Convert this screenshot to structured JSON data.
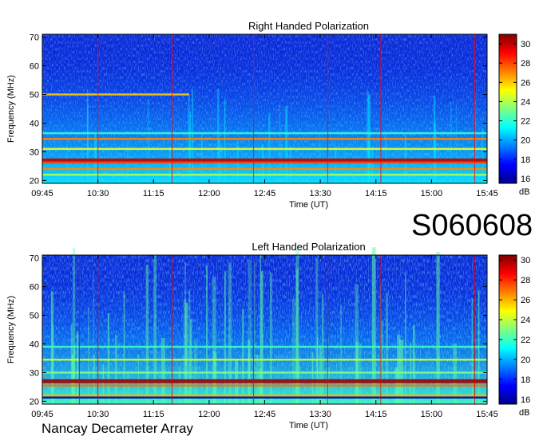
{
  "label": "S060608",
  "footer": "Nancay Decameter Array",
  "chart_data": [
    {
      "type": "heatmap",
      "title": "Right Handed Polarization",
      "xlabel": "Time (UT)",
      "ylabel": "Frequency (MHz)",
      "x_ticks": [
        "09:45",
        "10:30",
        "11:15",
        "12:00",
        "12:45",
        "13:30",
        "14:15",
        "15:00",
        "15:45"
      ],
      "y_ticks": [
        20,
        30,
        40,
        50,
        60,
        70
      ],
      "ylim": [
        19,
        71
      ],
      "colorbar": {
        "label": "dB",
        "ticks": [
          16,
          18,
          20,
          22,
          24,
          26,
          28,
          30
        ],
        "range": [
          15.5,
          31
        ]
      },
      "bands": [
        {
          "freq": 27,
          "level": 30,
          "extent": "full"
        },
        {
          "freq": 26.3,
          "level": 28,
          "extent": "full"
        },
        {
          "freq": 24,
          "level": 27,
          "extent": "full"
        },
        {
          "freq": 22,
          "level": 24,
          "extent": "full"
        },
        {
          "freq": 31,
          "level": 25,
          "extent": "full"
        },
        {
          "freq": 34.5,
          "level": 27,
          "extent": "full"
        },
        {
          "freq": 36.5,
          "level": 22,
          "extent": "full"
        },
        {
          "freq": 50,
          "level": 26,
          "extent": "partial"
        }
      ],
      "marker_times": [
        "10:30",
        "11:30",
        "12:36",
        "13:36",
        "14:19",
        "15:35"
      ]
    },
    {
      "type": "heatmap",
      "title": "Left Handed Polarization",
      "xlabel": "Time (UT)",
      "ylabel": "Frequency (MHz)",
      "x_ticks": [
        "09:45",
        "10:30",
        "11:15",
        "12:00",
        "12:45",
        "13:30",
        "14:15",
        "15:00",
        "15:45"
      ],
      "y_ticks": [
        20,
        30,
        40,
        50,
        60,
        70
      ],
      "ylim": [
        19,
        71
      ],
      "colorbar": {
        "label": "dB",
        "ticks": [
          16,
          18,
          20,
          22,
          24,
          26,
          28,
          30
        ],
        "range": [
          15.5,
          30.5
        ]
      },
      "bands": [
        {
          "freq": 27,
          "level": 30,
          "extent": "full"
        },
        {
          "freq": 25.5,
          "level": 27,
          "extent": "full"
        },
        {
          "freq": 22,
          "level": 26,
          "extent": "full"
        },
        {
          "freq": 21.3,
          "level": 16,
          "extent": "full"
        },
        {
          "freq": 30,
          "level": 23,
          "extent": "full"
        },
        {
          "freq": 34.5,
          "level": 24,
          "extent": "full"
        },
        {
          "freq": 39,
          "level": 22,
          "extent": "full"
        }
      ],
      "marker_times": [
        "10:15",
        "10:30",
        "11:30",
        "12:36",
        "13:36",
        "14:19",
        "15:35"
      ]
    }
  ]
}
